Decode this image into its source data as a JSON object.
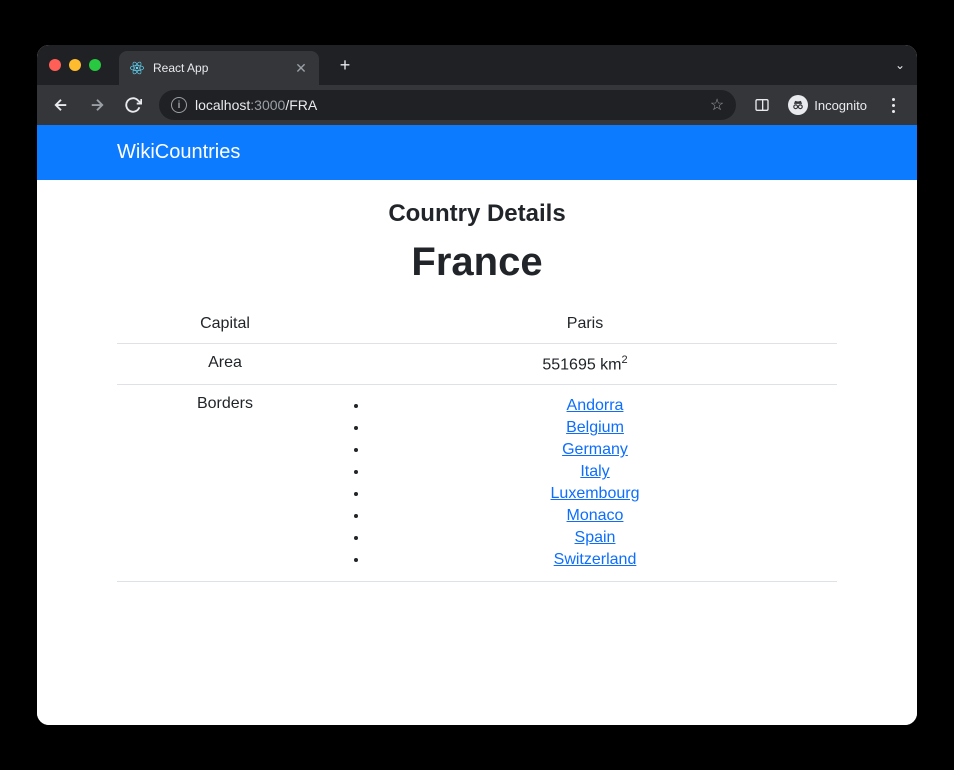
{
  "browser": {
    "tab_title": "React App",
    "url_host": "localhost",
    "url_port": ":3000",
    "url_path": "/FRA",
    "incognito_label": "Incognito"
  },
  "navbar": {
    "brand": "WikiCountries"
  },
  "page": {
    "heading": "Country Details",
    "country_name": "France",
    "rows": {
      "capital_label": "Capital",
      "capital_value": "Paris",
      "area_label": "Area",
      "area_value": "551695 km",
      "area_superscript": "2",
      "borders_label": "Borders"
    },
    "borders": [
      {
        "name": "Andorra"
      },
      {
        "name": "Belgium"
      },
      {
        "name": "Germany"
      },
      {
        "name": "Italy"
      },
      {
        "name": "Luxembourg"
      },
      {
        "name": "Monaco"
      },
      {
        "name": "Spain"
      },
      {
        "name": "Switzerland"
      }
    ]
  }
}
